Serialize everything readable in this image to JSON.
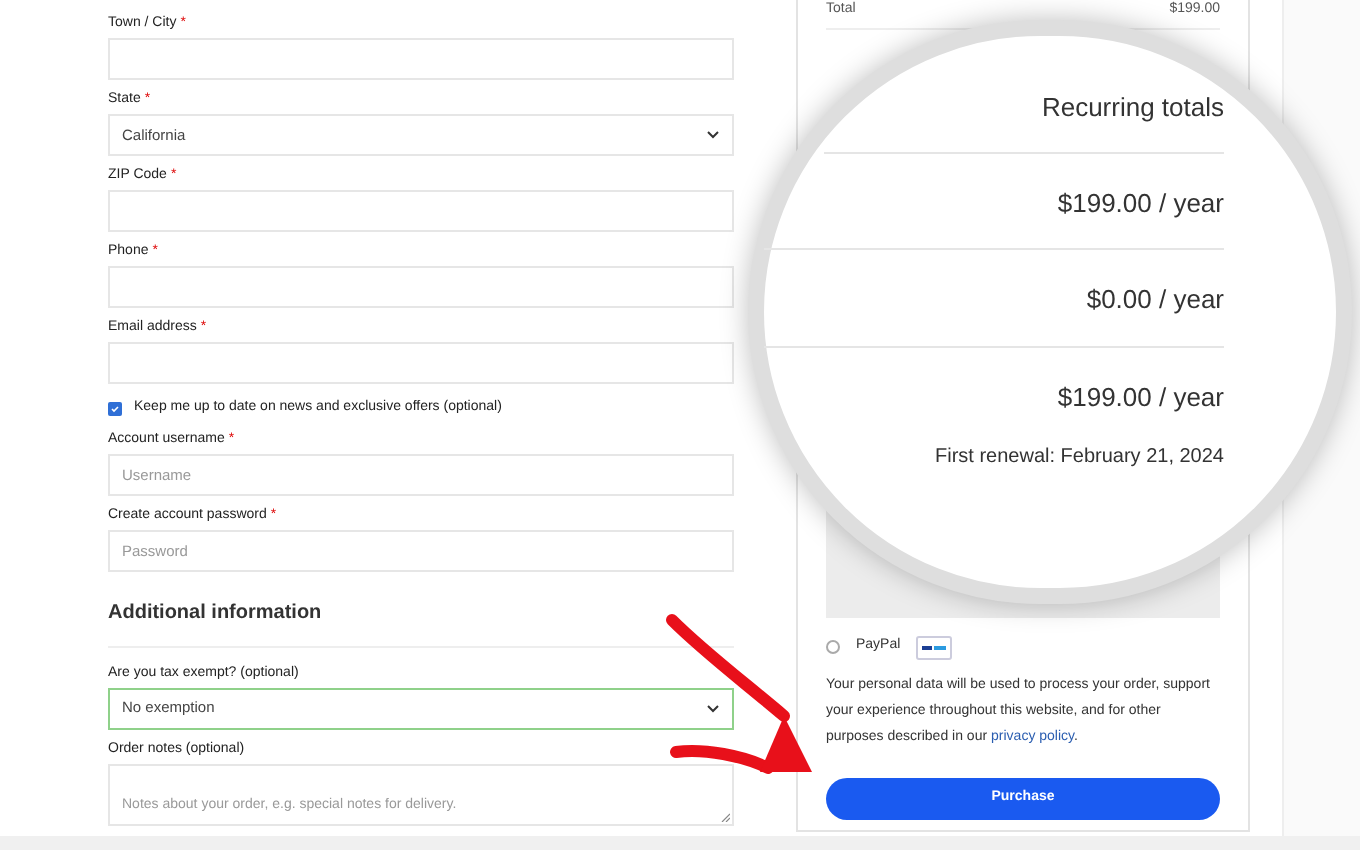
{
  "billing_fields": [
    {
      "kind": "input",
      "label": "Town / City",
      "required_mark": "*"
    },
    {
      "kind": "select",
      "label": "State",
      "required_mark": "*",
      "value": "California"
    },
    {
      "kind": "input",
      "label": "ZIP Code",
      "required_mark": "*"
    },
    {
      "kind": "input",
      "label": "Phone",
      "required_mark": "*"
    },
    {
      "kind": "input",
      "label": "Email address",
      "required_mark": "*"
    }
  ],
  "newsletter": {
    "label": "Keep me up to date on news and exclusive offers (optional)",
    "checked": true
  },
  "account_fields": [
    {
      "kind": "input",
      "label": "Account username",
      "required_mark": "*",
      "placeholder": "Username"
    },
    {
      "kind": "input",
      "label": "Create account password",
      "required_mark": "*",
      "placeholder": "Password"
    }
  ],
  "additional_information": {
    "heading": "Additional information",
    "fields": [
      {
        "kind": "select",
        "label": "Are you tax exempt? (optional)",
        "value": "No exemption",
        "focused": true
      },
      {
        "kind": "textarea",
        "label": "Order notes (optional)",
        "placeholder": "Notes about your order, e.g. special notes for delivery."
      }
    ]
  },
  "order_summary": {
    "total_label": "Total",
    "total_value": "$199.00",
    "payment_methods": [
      {
        "label": "PayPal",
        "selected": false
      }
    ],
    "privacy_text": "Your personal data will be used to process your order, support your experience throughout this website, and for other purposes described in our",
    "privacy_link": "privacy policy",
    "privacy_end": ".",
    "purchase_button": "Purchase"
  },
  "magnifier": {
    "title": "Recurring totals",
    "amounts": [
      "$199.00 / year",
      "$0.00 / year",
      "$199.00 / year"
    ],
    "first_renewal": "First renewal: February 21, 2024"
  }
}
